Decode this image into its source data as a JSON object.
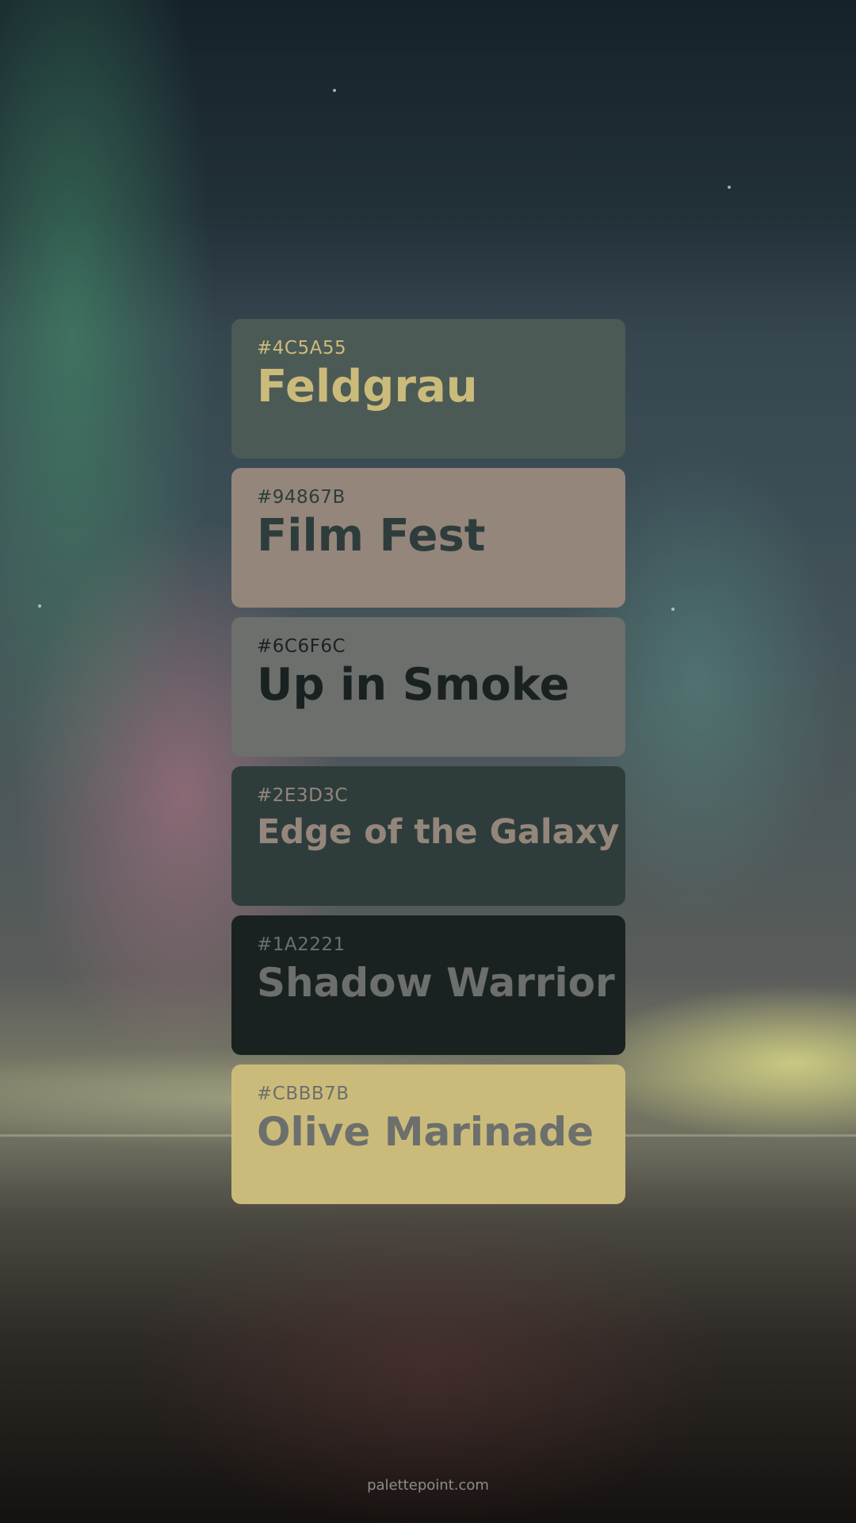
{
  "swatches": [
    {
      "hex": "#4C5A55",
      "name": "Feldgrau",
      "bg": "#4C5A55",
      "fg": "#CBBB7B"
    },
    {
      "hex": "#94867B",
      "name": "Film Fest",
      "bg": "#94867B",
      "fg": "#2E3D3C"
    },
    {
      "hex": "#6C6F6C",
      "name": "Up in Smoke",
      "bg": "#6C6F6C",
      "fg": "#1A2221"
    },
    {
      "hex": "#2E3D3C",
      "name": "Edge of the Galaxy",
      "bg": "#2E3D3C",
      "fg": "#94867B"
    },
    {
      "hex": "#1A2221",
      "name": "Shadow Warrior",
      "bg": "#1A2221",
      "fg": "#6C6F6C"
    },
    {
      "hex": "#CBBB7B",
      "name": "Olive Marinade",
      "bg": "#CBBB7B",
      "fg": "#6C6F6C"
    }
  ],
  "footer": {
    "text": "palettepoint.com"
  }
}
